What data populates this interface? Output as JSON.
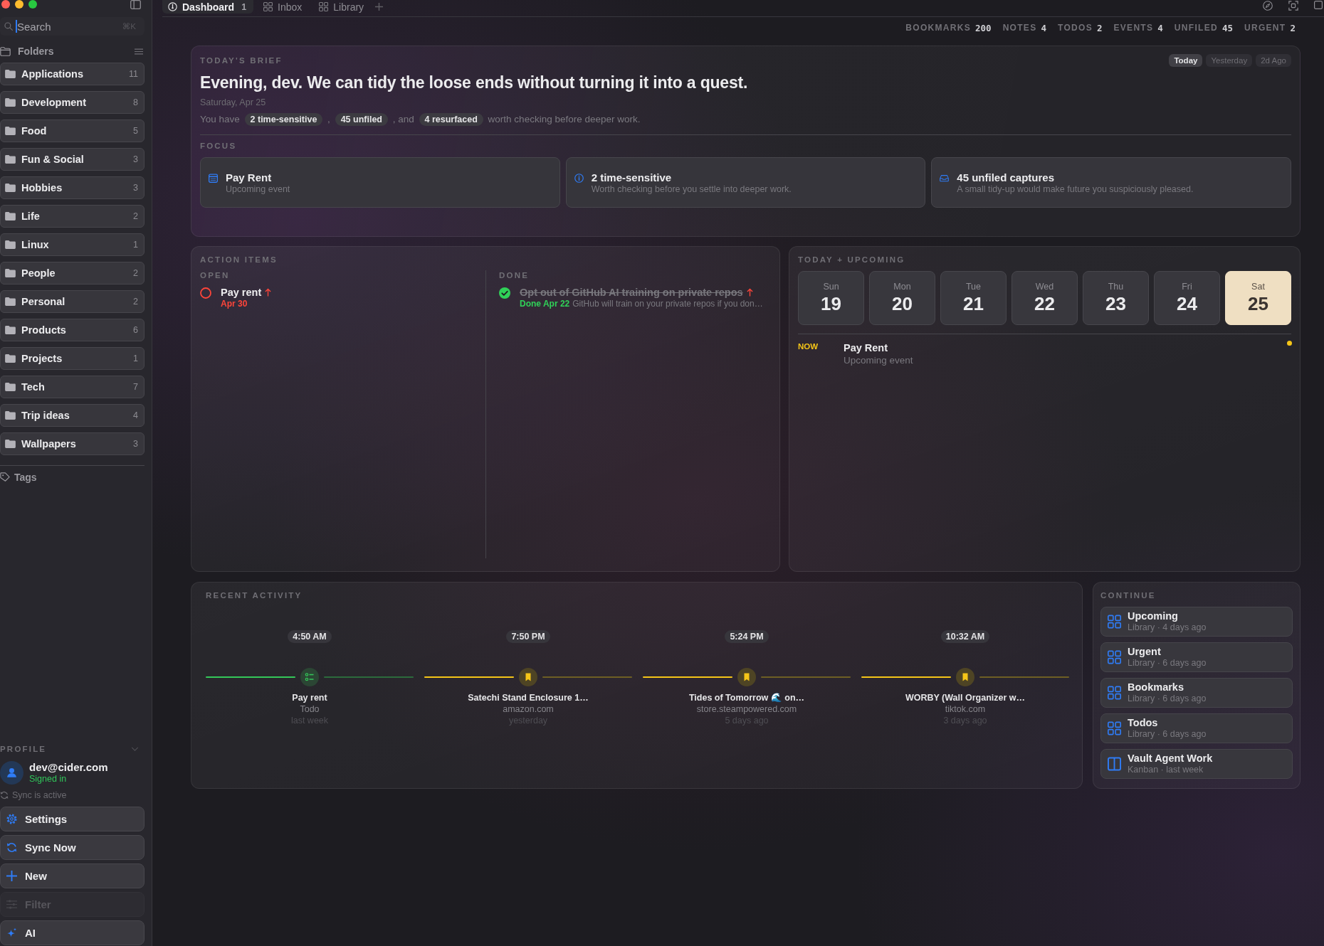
{
  "sidebar": {
    "search": {
      "placeholder": "Search",
      "shortcut": "⌘K"
    },
    "folders_heading": "Folders",
    "folders": [
      {
        "label": "Applications",
        "count": "11"
      },
      {
        "label": "Development",
        "count": "8"
      },
      {
        "label": "Food",
        "count": "5"
      },
      {
        "label": "Fun & Social",
        "count": "3"
      },
      {
        "label": "Hobbies",
        "count": "3"
      },
      {
        "label": "Life",
        "count": "2"
      },
      {
        "label": "Linux",
        "count": "1"
      },
      {
        "label": "People",
        "count": "2"
      },
      {
        "label": "Personal",
        "count": "2"
      },
      {
        "label": "Products",
        "count": "6"
      },
      {
        "label": "Projects",
        "count": "1"
      },
      {
        "label": "Tech",
        "count": "7"
      },
      {
        "label": "Trip ideas",
        "count": "4"
      },
      {
        "label": "Wallpapers",
        "count": "3"
      }
    ],
    "tags_heading": "Tags",
    "profile": {
      "heading": "PROFILE",
      "email": "dev@cider.com",
      "status": "Signed in",
      "sync": "Sync is active"
    },
    "actions": [
      {
        "kind": "settings",
        "label": "Settings",
        "disabled": false
      },
      {
        "kind": "sync",
        "label": "Sync Now",
        "disabled": false
      },
      {
        "kind": "new",
        "label": "New",
        "disabled": false
      },
      {
        "kind": "filter",
        "label": "Filter",
        "disabled": true
      },
      {
        "kind": "ai",
        "label": "AI",
        "disabled": false
      }
    ]
  },
  "tabs": [
    {
      "kind": "dashboard",
      "label": "Dashboard",
      "count": "1",
      "selected": true
    },
    {
      "kind": "grid",
      "label": "Inbox",
      "selected": false
    },
    {
      "kind": "grid",
      "label": "Library",
      "selected": false
    }
  ],
  "stats": [
    {
      "label": "BOOKMARKS",
      "value": "200"
    },
    {
      "label": "NOTES",
      "value": "4"
    },
    {
      "label": "TODOS",
      "value": "2"
    },
    {
      "label": "EVENTS",
      "value": "4"
    },
    {
      "label": "UNFILED",
      "value": "45"
    },
    {
      "label": "URGENT",
      "value": "2"
    }
  ],
  "brief": {
    "heading": "TODAY'S BRIEF",
    "ranges": [
      {
        "label": "Today",
        "selected": true
      },
      {
        "label": "Yesterday",
        "selected": false
      },
      {
        "label": "2d Ago",
        "selected": false
      }
    ],
    "title": "Evening, dev. We can tidy the loose ends without turning it into a quest.",
    "date": "Saturday, Apr 25",
    "summary": [
      {
        "kind": "text",
        "text": "You have"
      },
      {
        "kind": "chip",
        "text": "2 time-sensitive"
      },
      {
        "kind": "text",
        "text": ","
      },
      {
        "kind": "chip",
        "text": "45 unfiled"
      },
      {
        "kind": "text",
        "text": ", and"
      },
      {
        "kind": "chip",
        "text": "4 resurfaced"
      },
      {
        "kind": "text",
        "text": "worth checking before deeper work."
      }
    ],
    "focus_heading": "FOCUS",
    "focus": [
      {
        "kind": "event",
        "title": "Pay Rent",
        "subtitle": "Upcoming event"
      },
      {
        "kind": "alert",
        "title": "2 time-sensitive",
        "subtitle": "Worth checking before you settle into deeper work."
      },
      {
        "kind": "inbox",
        "title": "45 unfiled captures",
        "subtitle": "A small tidy-up would make future you suspiciously pleased."
      }
    ]
  },
  "action_items": {
    "heading": "ACTION ITEMS",
    "columns": [
      {
        "heading": "OPEN",
        "items": [
          {
            "title": "Pay rent",
            "due": "Apr 30",
            "urgent": true,
            "done": false
          }
        ]
      },
      {
        "heading": "DONE",
        "items": [
          {
            "title": "Opt out of GitHub AI training on private repos",
            "due": "Done Apr 22",
            "note": "GitHub will train on your private repos if you don…",
            "urgent": true,
            "done": true
          }
        ]
      }
    ]
  },
  "upcoming": {
    "heading": "TODAY + UPCOMING",
    "days": [
      {
        "weekday": "Sun",
        "day": "19",
        "selected": false
      },
      {
        "weekday": "Mon",
        "day": "20",
        "selected": false
      },
      {
        "weekday": "Tue",
        "day": "21",
        "selected": false
      },
      {
        "weekday": "Wed",
        "day": "22",
        "selected": false
      },
      {
        "weekday": "Thu",
        "day": "23",
        "selected": false
      },
      {
        "weekday": "Fri",
        "day": "24",
        "selected": false
      },
      {
        "weekday": "Sat",
        "day": "25",
        "selected": true
      }
    ],
    "events": [
      {
        "time": "NOW",
        "title": "Pay Rent",
        "subtitle": "Upcoming event",
        "color": "#f5c518"
      }
    ]
  },
  "recent_activity": {
    "heading": "RECENT ACTIVITY",
    "items": [
      {
        "kind": "todo",
        "time": "4:50 AM",
        "title": "Pay rent",
        "source": "Todo",
        "when": "last week"
      },
      {
        "kind": "bookmark",
        "time": "7:50 PM",
        "title": "Satechi Stand Enclosure 1…",
        "source": "amazon.com",
        "when": "yesterday"
      },
      {
        "kind": "bookmark",
        "time": "5:24 PM",
        "title": "Tides of Tomorrow 🌊 on…",
        "source": "store.steampowered.com",
        "when": "5 days ago"
      },
      {
        "kind": "bookmark",
        "time": "10:32 AM",
        "title": "WORBY (Wall Organizer w…",
        "source": "tiktok.com",
        "when": "3 days ago"
      }
    ]
  },
  "continue": {
    "heading": "CONTINUE",
    "items": [
      {
        "kind": "library",
        "title": "Upcoming",
        "meta": "Library · 4 days ago"
      },
      {
        "kind": "library",
        "title": "Urgent",
        "meta": "Library · 6 days ago"
      },
      {
        "kind": "library",
        "title": "Bookmarks",
        "meta": "Library · 6 days ago"
      },
      {
        "kind": "library",
        "title": "Todos",
        "meta": "Library · 6 days ago"
      },
      {
        "kind": "kanban",
        "title": "Vault Agent Work",
        "meta": "Kanban · last week"
      }
    ]
  }
}
